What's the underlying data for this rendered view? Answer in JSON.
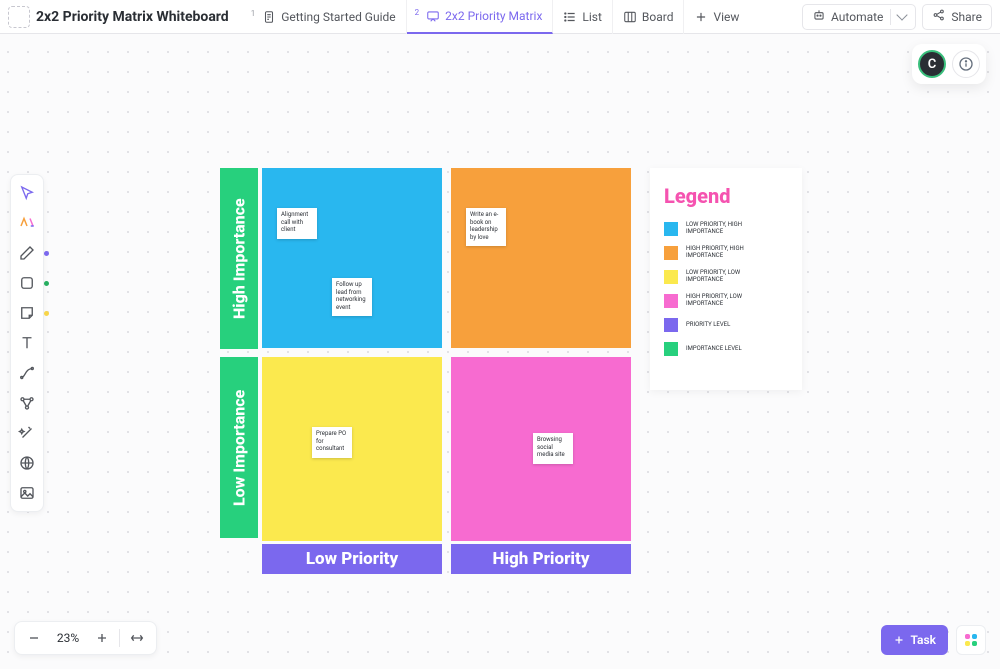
{
  "header": {
    "title": "2x2 Priority Matrix Whiteboard",
    "tabs": [
      {
        "label": "Getting Started Guide"
      },
      {
        "label": "2x2 Priority Matrix"
      },
      {
        "label": "List"
      },
      {
        "label": "Board"
      },
      {
        "label": "View"
      }
    ],
    "automate_label": "Automate",
    "share_label": "Share"
  },
  "corner": {
    "avatar_initial": "C"
  },
  "axes": {
    "y_top": "High Importance",
    "y_bottom": "Low Importance",
    "x_left": "Low Priority",
    "x_right": "High Priority"
  },
  "notes": {
    "q1a": "Alignment call with client",
    "q1b": "Follow up lead from networking event",
    "q2a": "Write an e-book on leadership by love",
    "q3a": "Prepare PO for consultant",
    "q4a": "Browsing social media site"
  },
  "legend": {
    "title": "Legend",
    "items": [
      {
        "color": "#29b7ef",
        "label": "LOW PRIORITY, HIGH IMPORTANCE"
      },
      {
        "color": "#f7a03c",
        "label": "HIGH PRIORITY, HIGH IMPORTANCE"
      },
      {
        "color": "#fbe94e",
        "label": "LOW PRIORITY, LOW IMPORTANCE"
      },
      {
        "color": "#f76bd0",
        "label": "HIGH PRIORITY, LOW IMPORTANCE"
      },
      {
        "color": "#7b68ee",
        "label": "PRIORITY LEVEL"
      },
      {
        "color": "#27d07d",
        "label": "IMPORTANCE LEVEL"
      }
    ]
  },
  "zoom": {
    "value": "23%"
  },
  "task": {
    "button_label": "Task"
  }
}
